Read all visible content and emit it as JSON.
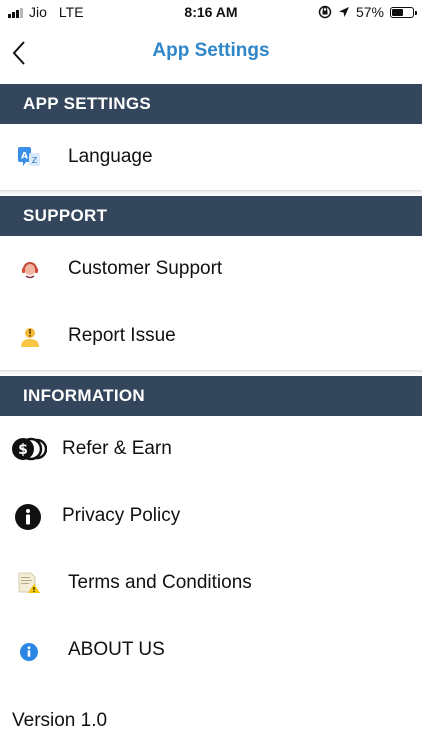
{
  "status_bar": {
    "carrier": "Jio",
    "network": "LTE",
    "time": "8:16 AM",
    "battery_percent": "57%",
    "battery_level": 0.57
  },
  "nav": {
    "title": "App Settings",
    "back_icon": "chevron-left-icon",
    "title_color": "#2f86c8"
  },
  "sections": {
    "app_settings": {
      "header": "APP SETTINGS",
      "items": [
        {
          "label": "Language",
          "icon": "translate-icon"
        }
      ]
    },
    "support": {
      "header": "SUPPORT",
      "items": [
        {
          "label": "Customer Support",
          "icon": "headset-icon"
        },
        {
          "label": "Report Issue",
          "icon": "report-user-icon"
        }
      ]
    },
    "information": {
      "header": "INFORMATION",
      "items": [
        {
          "label": "Refer & Earn",
          "icon": "dollar-coins-icon"
        },
        {
          "label": "Privacy Policy",
          "icon": "info-icon"
        },
        {
          "label": "Terms and Conditions",
          "icon": "document-warning-icon"
        },
        {
          "label": "ABOUT US",
          "icon": "info-circle-blue-icon"
        }
      ]
    }
  },
  "footer": {
    "version": "Version 1.0"
  },
  "colors": {
    "header_bg": "#34465c",
    "header_text": "#ffffff",
    "accent": "#2f86c8"
  }
}
